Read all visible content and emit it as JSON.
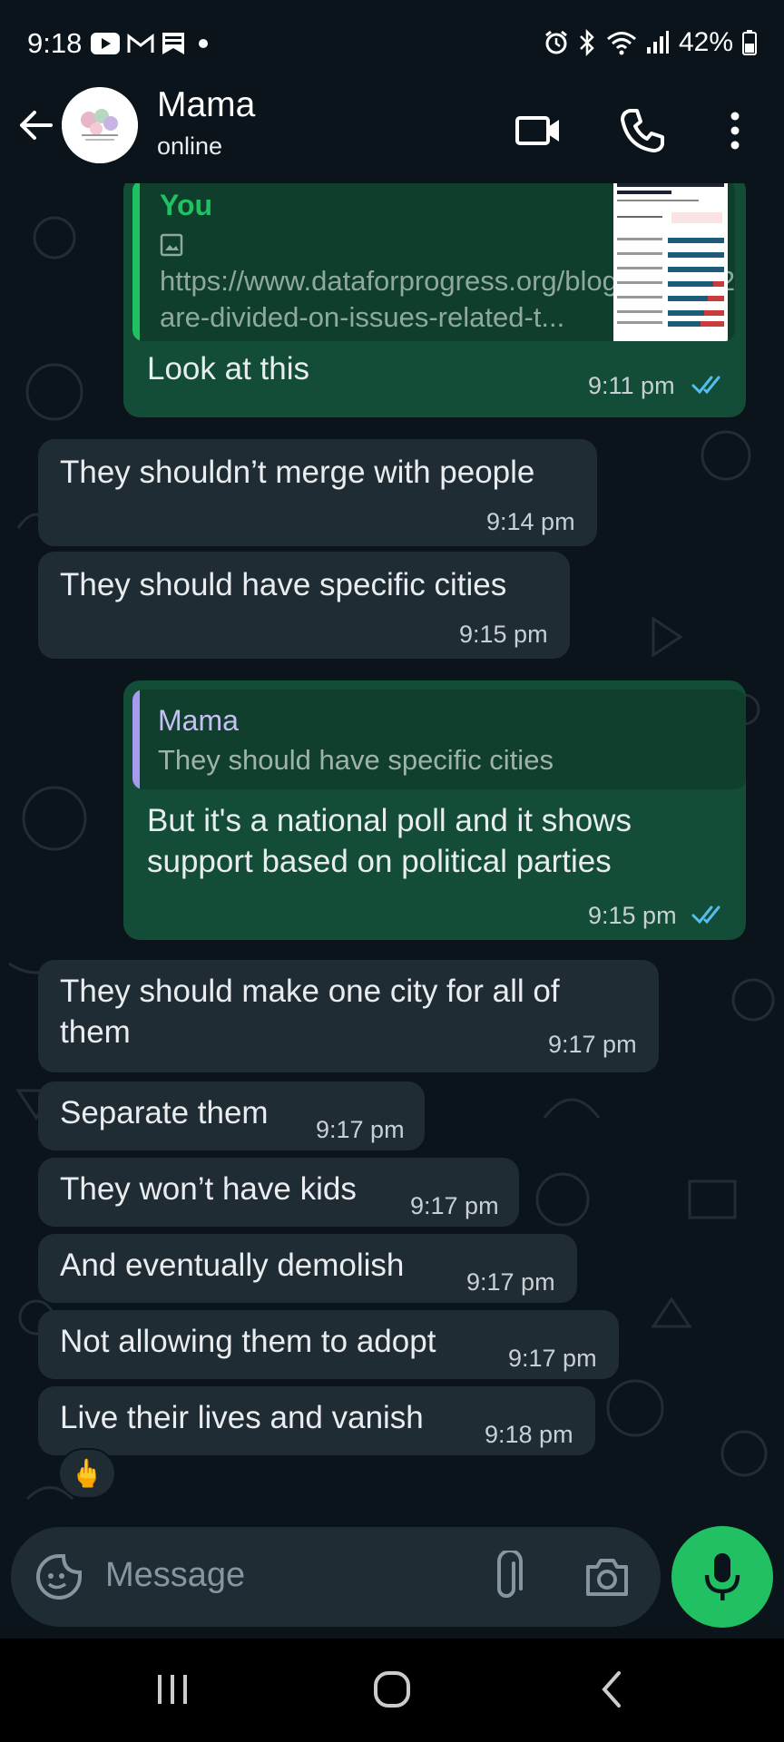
{
  "status_bar": {
    "time": "9:18",
    "battery": "42%",
    "icons": [
      "youtube-icon",
      "gmail-icon",
      "bookmark-icon",
      "dot-icon",
      "alarm-icon",
      "bluetooth-icon",
      "wifi-icon",
      "signal-icon",
      "battery-icon"
    ]
  },
  "header": {
    "contact_name": "Mama",
    "status": "online",
    "icons": [
      "back-arrow-icon",
      "video-call-icon",
      "phone-icon",
      "more-vert-icon"
    ]
  },
  "messages": [
    {
      "direction": "out",
      "link_preview": {
        "sender": "You",
        "url": "https://www.dataforprogress.org/blog/2025/3/27/americans-are-divided-on-issues-related-t..."
      },
      "text": "Look at this",
      "time": "9:11 pm",
      "read": true
    },
    {
      "direction": "in",
      "text": "They shouldn’t merge with people",
      "time": "9:14 pm"
    },
    {
      "direction": "in",
      "text": "They should have specific cities",
      "time": "9:15 pm"
    },
    {
      "direction": "out",
      "quote": {
        "name": "Mama",
        "text": "They should have specific cities"
      },
      "text": "But it's a national poll and it shows\nsupport based on political parties",
      "time": "9:15 pm",
      "read": true
    },
    {
      "direction": "in",
      "text": "They should make one city for all of\nthem",
      "time": "9:17 pm"
    },
    {
      "direction": "in",
      "text": "Separate them",
      "time": "9:17 pm"
    },
    {
      "direction": "in",
      "text": "They won’t have kids",
      "time": "9:17 pm"
    },
    {
      "direction": "in",
      "text": "And eventually demolish",
      "time": "9:17 pm"
    },
    {
      "direction": "in",
      "text": "Not allowing them to adopt",
      "time": "9:17 pm"
    },
    {
      "direction": "in",
      "text": "Live their lives and vanish",
      "time": "9:18 pm",
      "reaction": "🖕"
    }
  ],
  "input": {
    "placeholder": "Message",
    "icons": [
      "sticker-icon",
      "attach-icon",
      "camera-icon",
      "mic-icon"
    ]
  },
  "colors": {
    "background": "#0b141a",
    "outgoing_bubble": "#144d37",
    "incoming_bubble": "#202c33",
    "accent": "#21c063",
    "read_ticks": "#53bdeb"
  }
}
